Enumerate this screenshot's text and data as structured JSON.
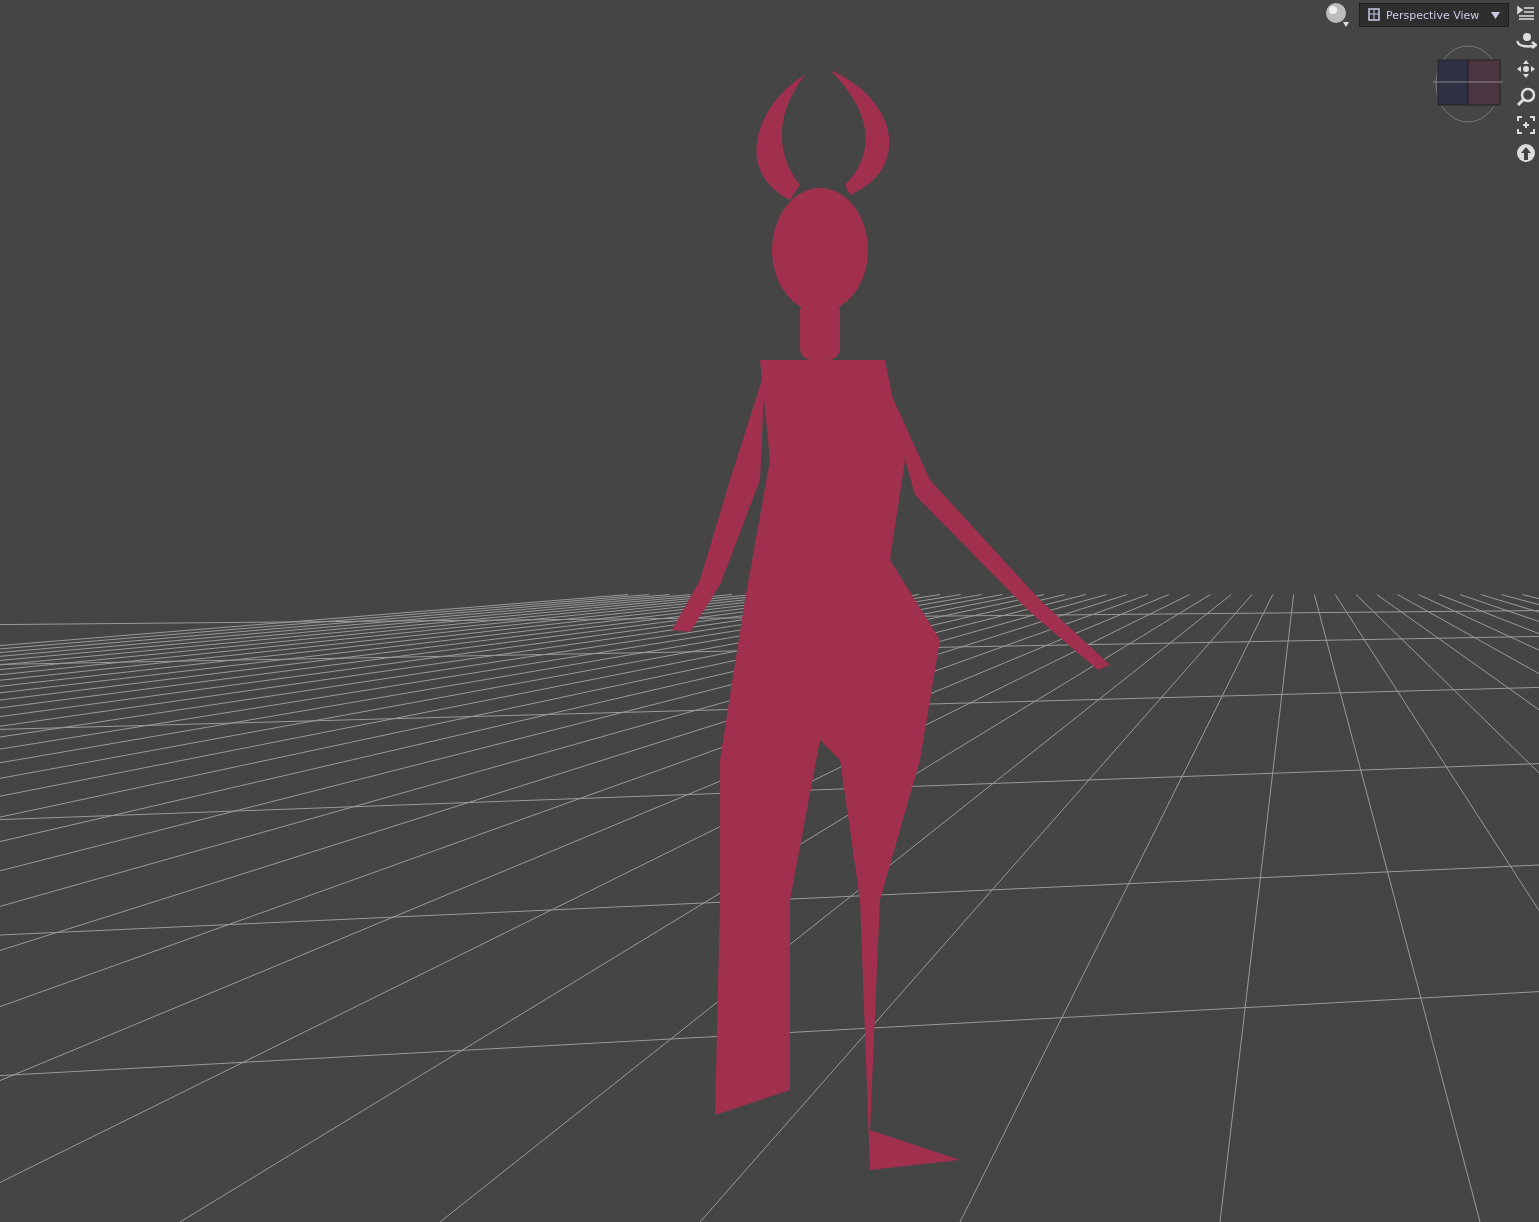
{
  "viewport": {
    "view_menu": {
      "label": "Perspective View"
    }
  }
}
